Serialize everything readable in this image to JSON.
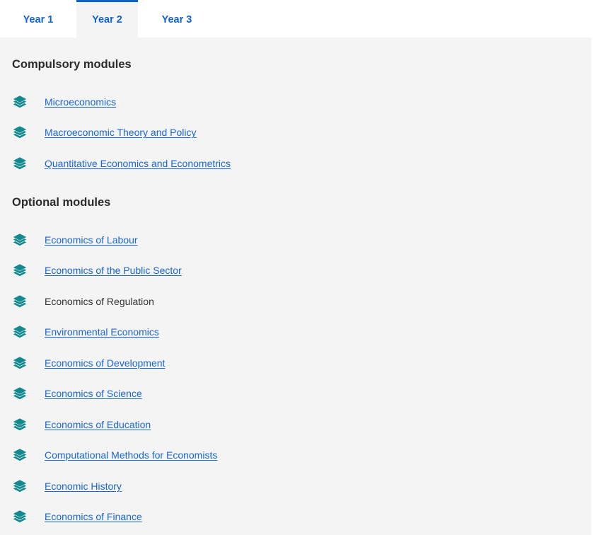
{
  "tabs": [
    {
      "label": "Year 1",
      "active": false,
      "name": "tab-year-1"
    },
    {
      "label": "Year 2",
      "active": true,
      "name": "tab-year-2"
    },
    {
      "label": "Year 3",
      "active": false,
      "name": "tab-year-3"
    }
  ],
  "colors": {
    "panel_background": "#f4f4f4",
    "tab_text": "#1363cc",
    "active_tab_border": "#0b62c4",
    "link": "#1a66d6",
    "plain_text": "#333333",
    "heading": "#2b2b2b",
    "icon_teal": "#11898f"
  },
  "sections": [
    {
      "heading": "Compulsory modules",
      "modules": [
        {
          "label": "Microeconomics",
          "is_link": true,
          "icon": "layers-stack-icon"
        },
        {
          "label": "Macroeconomic Theory and Policy",
          "is_link": true,
          "icon": "layers-stack-icon"
        },
        {
          "label": "Quantitative Economics and Econometrics",
          "is_link": true,
          "icon": "layers-stack-icon"
        }
      ]
    },
    {
      "heading": "Optional modules",
      "modules": [
        {
          "label": "Economics of Labour",
          "is_link": true,
          "icon": "layers-stack-icon"
        },
        {
          "label": "Economics of the Public Sector",
          "is_link": true,
          "icon": "layers-stack-icon"
        },
        {
          "label": "Economics of Regulation",
          "is_link": false,
          "icon": "layers-stack-icon"
        },
        {
          "label": "Environmental Economics",
          "is_link": true,
          "icon": "layers-stack-icon"
        },
        {
          "label": "Economics of Development",
          "is_link": true,
          "icon": "layers-stack-icon"
        },
        {
          "label": "Economics of Science",
          "is_link": true,
          "icon": "layers-stack-icon"
        },
        {
          "label": "Economics of Education",
          "is_link": true,
          "icon": "layers-stack-icon"
        },
        {
          "label": "Computational Methods for Economists",
          "is_link": true,
          "icon": "layers-stack-icon"
        },
        {
          "label": "Economic History",
          "is_link": true,
          "icon": "layers-stack-icon"
        },
        {
          "label": "Economics of Finance",
          "is_link": true,
          "icon": "layers-stack-icon"
        }
      ]
    }
  ]
}
